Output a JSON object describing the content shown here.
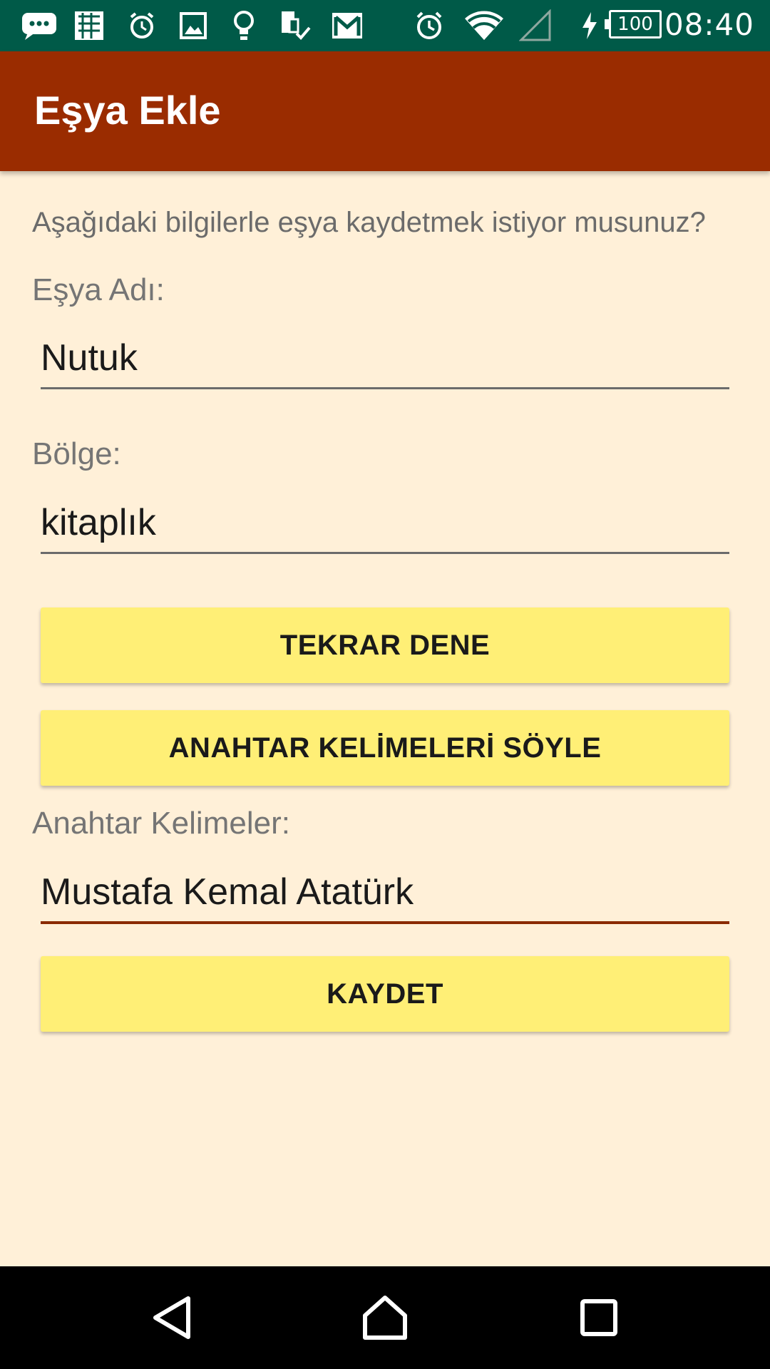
{
  "status_bar": {
    "time": "08:40",
    "battery_level": "100",
    "icons": [
      "message-icon",
      "app-icon",
      "alarm-clock-icon",
      "image-icon",
      "lightbulb-icon",
      "sim-check-icon",
      "gmail-icon",
      "alarm-icon",
      "wifi-icon",
      "signal-icon",
      "charging-icon",
      "battery-icon"
    ]
  },
  "app_bar": {
    "title": "Eşya Ekle"
  },
  "form": {
    "prompt": "Aşağıdaki bilgilerle eşya kaydetmek istiyor musunuz?",
    "item_name_label": "Eşya Adı:",
    "item_name_value": "Nutuk",
    "region_label": "Bölge:",
    "region_value": "kitaplık",
    "retry_button": "TEKRAR DENE",
    "say_keywords_button": "ANAHTAR KELİMELERİ SÖYLE",
    "keywords_label": "Anahtar Kelimeler:",
    "keywords_value": "Mustafa Kemal Atatürk",
    "save_button": "KAYDET"
  },
  "colors": {
    "status_bar": "#005A48",
    "app_bar": "#9A2C00",
    "background": "#FFF0D8",
    "button": "#FFEF76",
    "active_underline": "#8A2A00"
  },
  "nav_bar": {
    "icons": [
      "back-icon",
      "home-icon",
      "recents-icon"
    ]
  }
}
